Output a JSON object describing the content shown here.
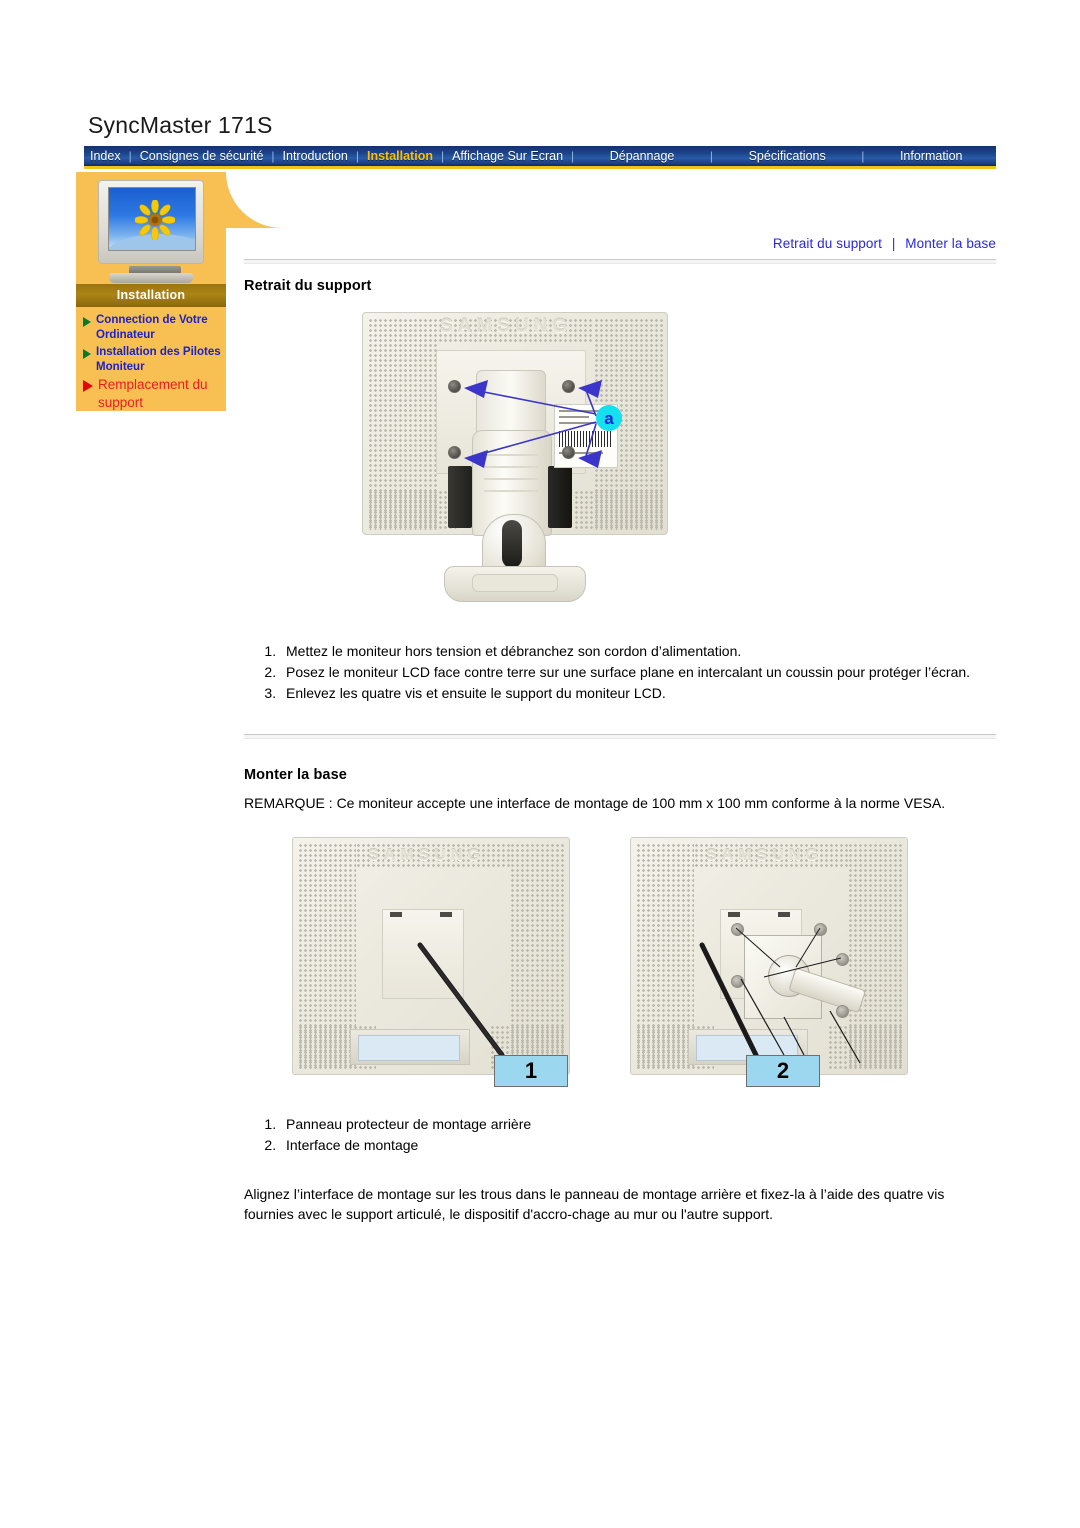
{
  "page": {
    "title": "SyncMaster 171S"
  },
  "nav": {
    "items": [
      {
        "label": "Index",
        "active": false
      },
      {
        "label": "Consignes de sécurité",
        "active": false
      },
      {
        "label": "Introduction",
        "active": false
      },
      {
        "label": "Installation",
        "active": true
      },
      {
        "label": "Affichage Sur Ecran",
        "active": false
      },
      {
        "label": "Dépannage",
        "active": false
      },
      {
        "label": "Spécifications",
        "active": false
      },
      {
        "label": "Information",
        "active": false
      }
    ],
    "separator": "|",
    "accent_color": "#ffbf00",
    "bar_color": "#1b4488",
    "underline_color": "#f2c21a"
  },
  "sidebar": {
    "thumbnail_name": "monitor-sunflower-thumbnail",
    "section_label": "Installation",
    "panel_color": "#f8c053",
    "label_band_color": "#9a7510",
    "items": [
      {
        "label": "Connection de Votre Ordinateur",
        "active": false,
        "marker_color": "#0a7a2a",
        "text_color": "#1b22c8"
      },
      {
        "label": "Installation des Pilotes Moniteur",
        "active": false,
        "marker_color": "#0a7a2a",
        "text_color": "#1b22c8"
      },
      {
        "label": "Remplacement du support",
        "active": true,
        "marker_color": "#e8000b",
        "text_color": "#ed1b23"
      }
    ]
  },
  "breadcrumb": {
    "first": "Retrait du support",
    "separator": "|",
    "second": "Monter la base",
    "link_color": "#2b27e0"
  },
  "section_remove": {
    "heading": "Retrait du support",
    "figure": {
      "name": "monitor-rear-with-stand",
      "brand_emboss": "SAMSUNG",
      "callout_label": "a",
      "callout_color": "#14e0f0",
      "arrow_color": "#3b35c9",
      "screw_count": 4
    },
    "steps": [
      "Mettez le moniteur hors tension et débranchez son cordon d’alimentation.",
      "Posez le moniteur LCD face contre terre sur une surface plane en intercalant un coussin pour protéger l’écran.",
      "Enlevez les quatre vis et ensuite le support du moniteur LCD."
    ]
  },
  "section_mount": {
    "heading": "Monter la base",
    "note": "REMARQUE : Ce moniteur accepte une interface de montage de 100 mm x 100 mm conforme à la norme VESA.",
    "figure": {
      "name": "vesa-mount-figures",
      "brand_emboss": "SAMSUNG",
      "label_box_color": "#9bd7ee",
      "label_left": "1",
      "label_right": "2"
    },
    "legend": [
      "Panneau protecteur de montage arrière",
      "Interface de montage"
    ],
    "paragraph": "Alignez l’interface de montage sur les trous dans le panneau de montage arrière et fixez-la à l’aide des quatre vis fournies avec le support articulé, le dispositif d'accro-chage au mur ou l'autre support."
  }
}
